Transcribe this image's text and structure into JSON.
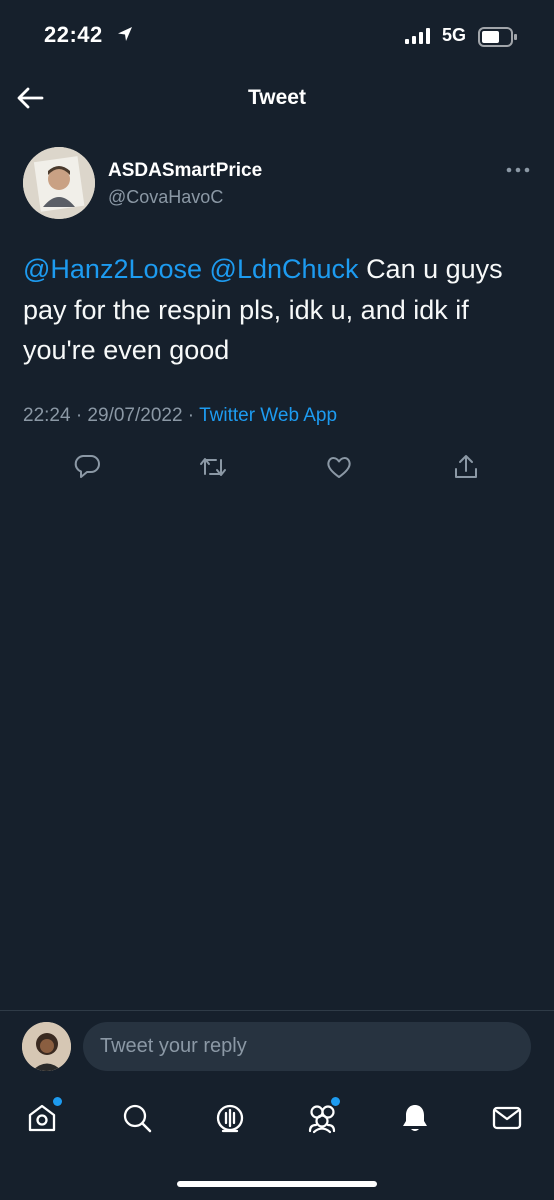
{
  "status_bar": {
    "time": "22:42",
    "network": "5G",
    "icons": [
      "location-arrow-icon",
      "signal-bars-icon",
      "battery-icon"
    ]
  },
  "header": {
    "title": "Tweet",
    "back_icon": "back-arrow-icon"
  },
  "tweet": {
    "author_name": "ASDASmartPrice",
    "author_handle": "@CovaHavoC",
    "mention_1": "@Hanz2Loose",
    "mention_2": "@LdnChuck",
    "body": "Can u guys pay for the respin pls, idk u, and idk if you're even good",
    "timestamp": "22:24 · 29/07/2022 · ",
    "source": "Twitter Web App",
    "actions": [
      "reply-icon",
      "retweet-icon",
      "like-icon",
      "share-icon"
    ]
  },
  "reply_bar": {
    "placeholder": "Tweet your reply"
  },
  "tab_bar": {
    "items": [
      "home-icon",
      "search-icon",
      "spaces-icon",
      "communities-icon",
      "notifications-icon",
      "messages-icon"
    ]
  },
  "colors": {
    "background": "#16202c",
    "accent": "#1d9bf0",
    "secondary_text": "#8b98a5"
  }
}
